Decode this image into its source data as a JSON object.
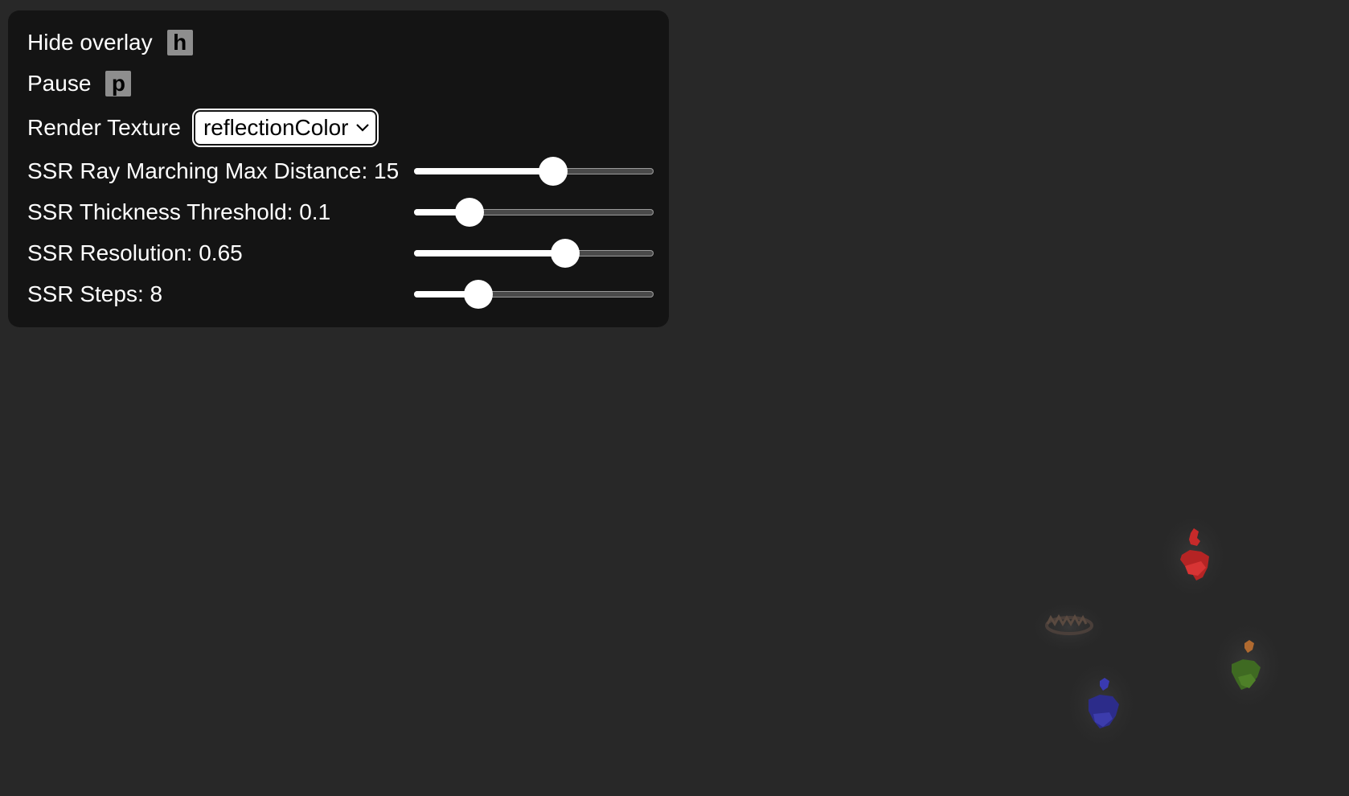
{
  "overlay": {
    "hide_label": "Hide overlay",
    "hide_key": "h",
    "pause_label": "Pause",
    "pause_key": "p",
    "render_texture_label": "Render Texture",
    "render_texture_value": "reflectionColor"
  },
  "sliders": [
    {
      "label": "SSR Ray Marching Max Distance: 15",
      "level": 0.58
    },
    {
      "label": "SSR Thickness Threshold: 0.1",
      "level": 0.23
    },
    {
      "label": "SSR Resolution: 0.65",
      "level": 0.63
    },
    {
      "label": "SSR Steps: 8",
      "level": 0.27
    }
  ],
  "scene": {
    "background": "#282828",
    "objects": [
      {
        "name": "red-figure",
        "color": "#c62a2a"
      },
      {
        "name": "crown-object",
        "color": "#4a3f3a"
      },
      {
        "name": "green-figure",
        "color": "#3f6a22"
      },
      {
        "name": "blue-figure",
        "color": "#2c2c8a"
      }
    ]
  }
}
